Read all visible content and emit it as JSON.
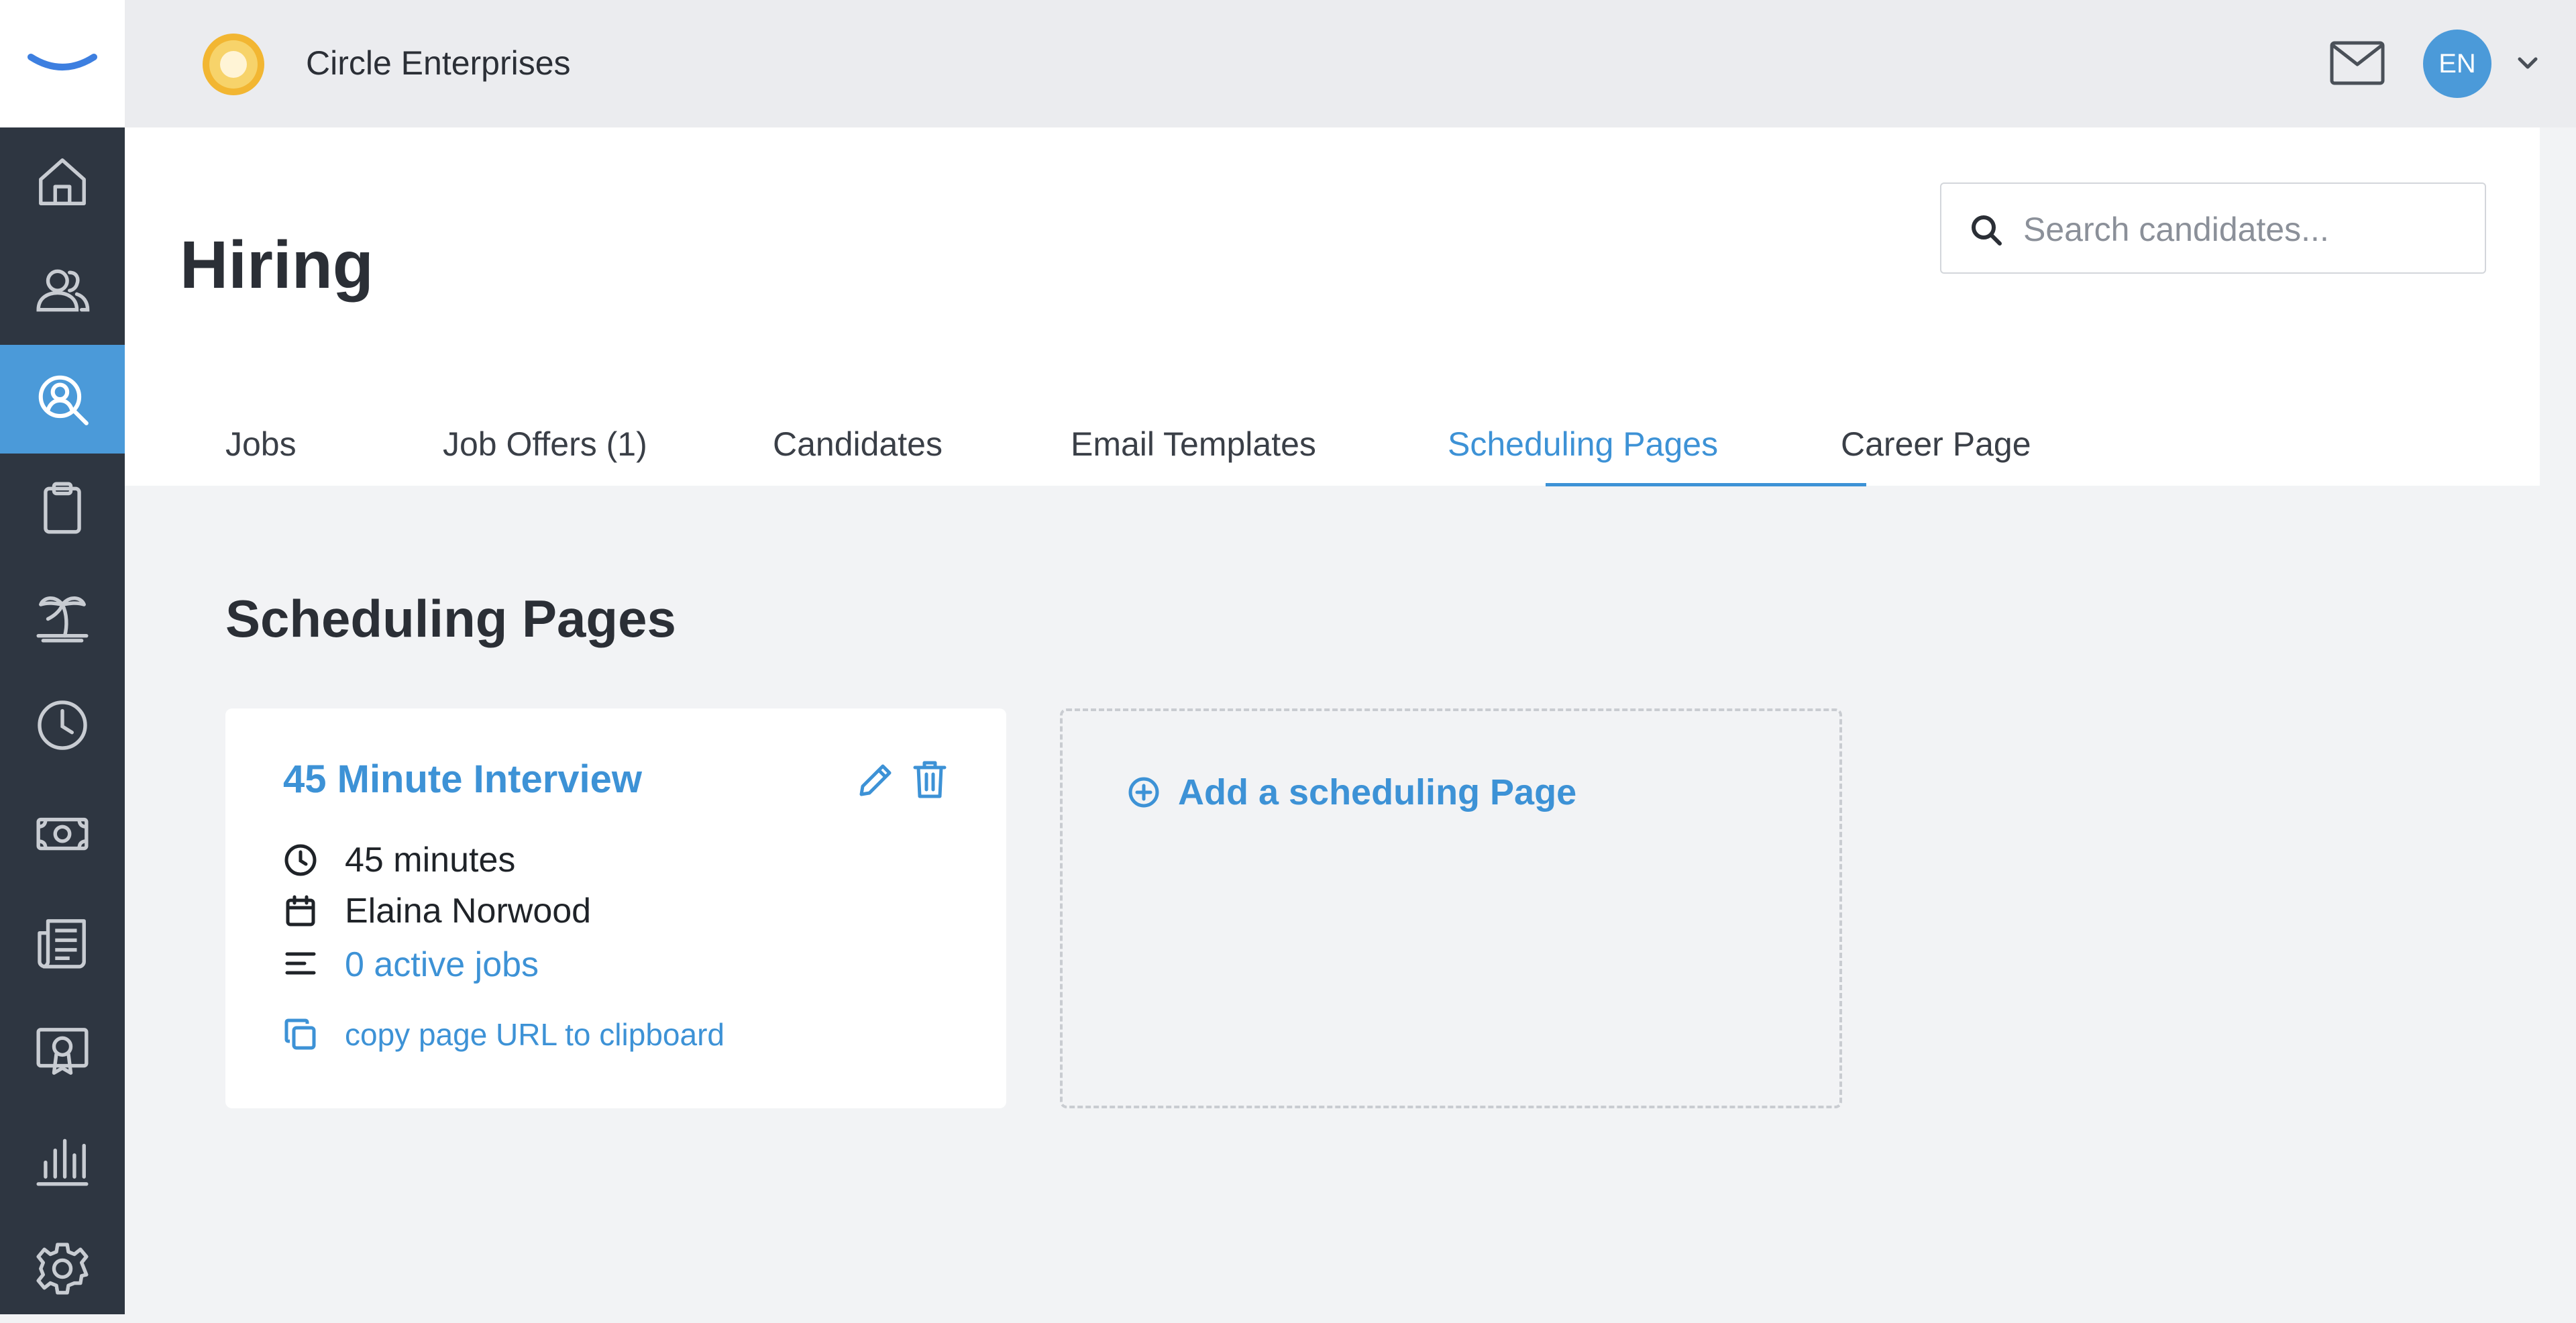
{
  "sidebar": {
    "items": [
      {
        "icon": "home-icon"
      },
      {
        "icon": "people-icon"
      },
      {
        "icon": "hiring-search-icon",
        "active": true
      },
      {
        "icon": "clipboard-icon"
      },
      {
        "icon": "palm-tree-icon"
      },
      {
        "icon": "clock-icon"
      },
      {
        "icon": "money-icon"
      },
      {
        "icon": "newspaper-icon"
      },
      {
        "icon": "certificate-icon"
      },
      {
        "icon": "bar-chart-icon"
      },
      {
        "icon": "gear-icon"
      }
    ]
  },
  "topbar": {
    "company_name": "Circle Enterprises",
    "avatar_initials": "EN"
  },
  "header": {
    "title": "Hiring",
    "search_placeholder": "Search candidates..."
  },
  "tabs": [
    {
      "label": "Jobs"
    },
    {
      "label": "Job Offers (1)"
    },
    {
      "label": "Candidates"
    },
    {
      "label": "Email Templates"
    },
    {
      "label": "Scheduling Pages",
      "active": true
    },
    {
      "label": "Career Page"
    }
  ],
  "main": {
    "section_title": "Scheduling Pages",
    "card": {
      "title": "45 Minute Interview",
      "duration": "45 minutes",
      "owner": "Elaina Norwood",
      "active_jobs": "0 active jobs",
      "copy_link": "copy page URL to clipboard"
    },
    "add_label": "Add a scheduling Page"
  },
  "colors": {
    "accent": "#3d92d6",
    "sidebar_bg": "#2e3641",
    "sidebar_active": "#4b9ad9",
    "page_bg": "#f2f3f5"
  }
}
